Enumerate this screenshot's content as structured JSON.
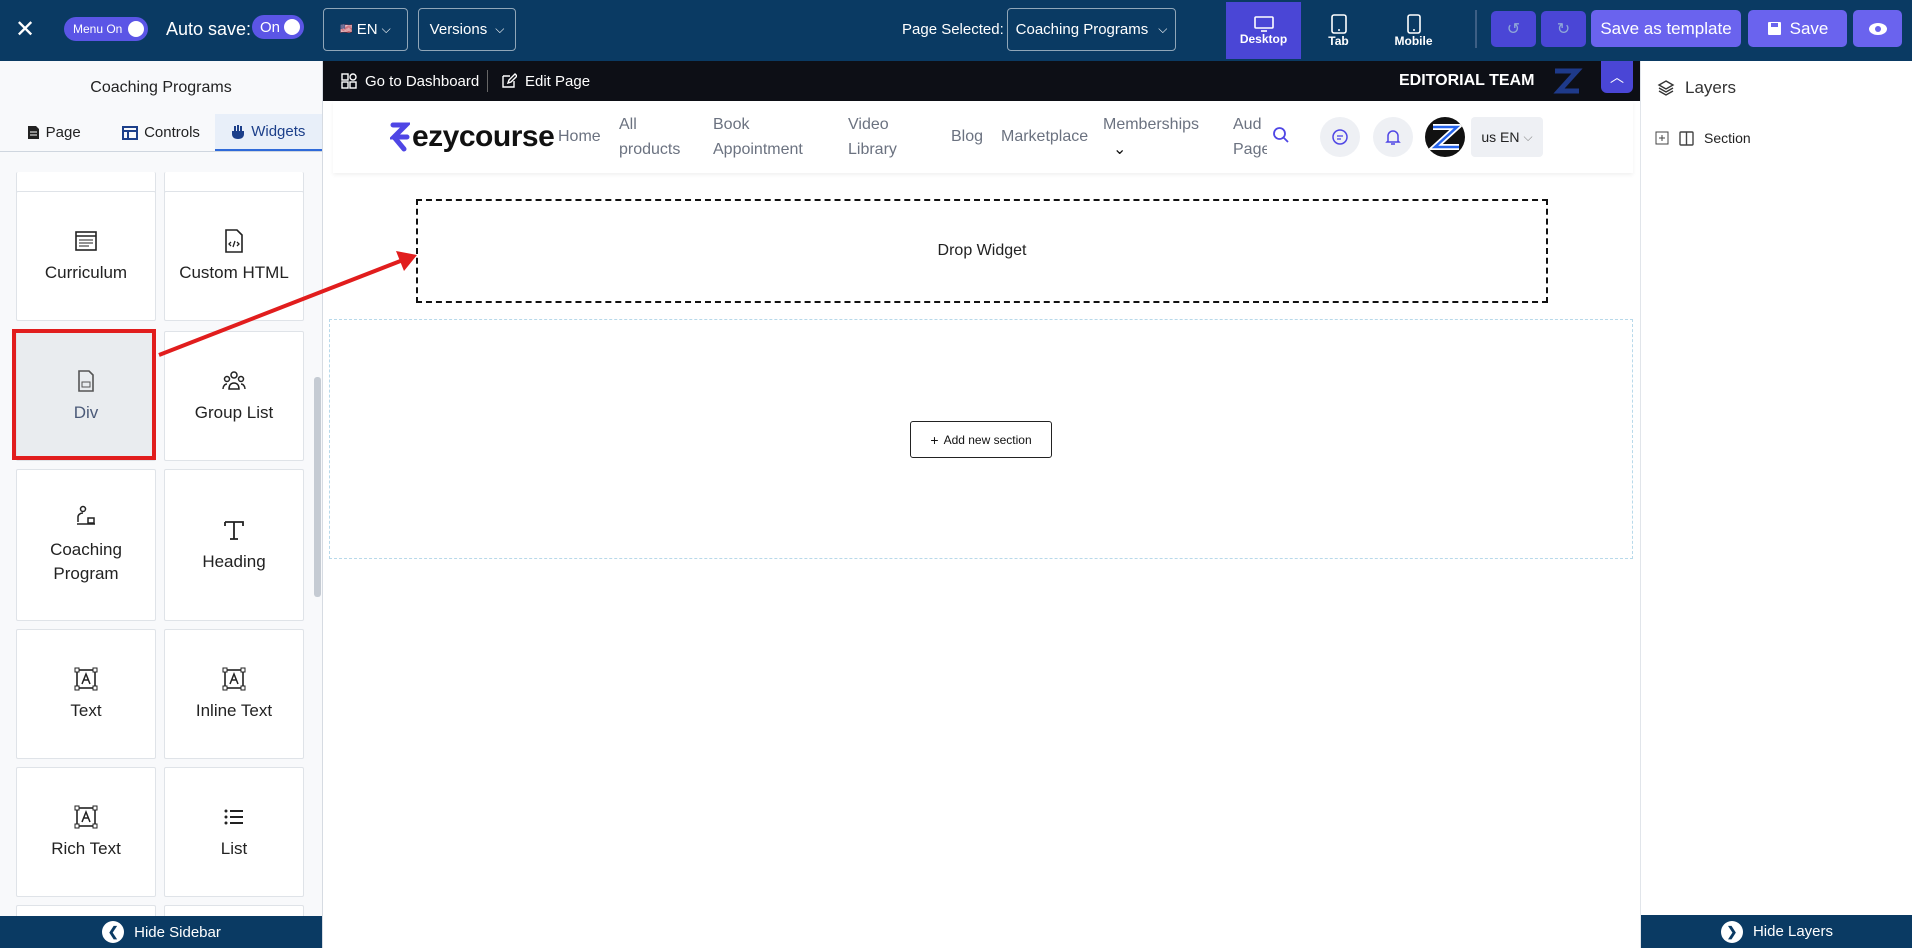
{
  "topbar": {
    "menu_toggle_label": "Menu On",
    "autosave_label": "Auto save:",
    "autosave_toggle": "On",
    "language": "EN",
    "versions": "Versions",
    "page_selected_label": "Page Selected:",
    "page_selected_value": "Coaching Programs",
    "devices": [
      {
        "label": "Desktop",
        "icon": "desktop-icon",
        "active": true
      },
      {
        "label": "Tab",
        "icon": "tablet-icon",
        "active": false
      },
      {
        "label": "Mobile",
        "icon": "mobile-icon",
        "active": false
      }
    ],
    "save_template": "Save as template",
    "save": "Save",
    "colors": {
      "bar": "#0a3a63",
      "accent": "#6a63ee"
    }
  },
  "sidebar": {
    "title": "Coaching Programs",
    "tabs": [
      "Page",
      "Controls",
      "Widgets"
    ],
    "active_tab": "Widgets",
    "widgets": [
      "Curriculum",
      "Custom HTML",
      "Div",
      "Group List",
      "Coaching Program",
      "Heading",
      "Text",
      "Inline Text",
      "Rich Text",
      "List"
    ],
    "highlighted_widget": "Div",
    "hide_label": "Hide Sidebar"
  },
  "editbar": {
    "dashboard": "Go to Dashboard",
    "edit_page": "Edit Page",
    "team": "EDITORIAL TEAM"
  },
  "site": {
    "logo": "ezycourse",
    "nav": [
      "Home",
      "All products",
      "Book Appointment",
      "Video Library",
      "Blog",
      "Marketplace",
      "Memberships",
      "Aud Page"
    ],
    "locale": "us EN"
  },
  "canvas": {
    "drop_label": "Drop Widget",
    "add_section": "Add new section"
  },
  "layers": {
    "title": "Layers",
    "items": [
      "Section"
    ],
    "hide_label": "Hide Layers"
  }
}
